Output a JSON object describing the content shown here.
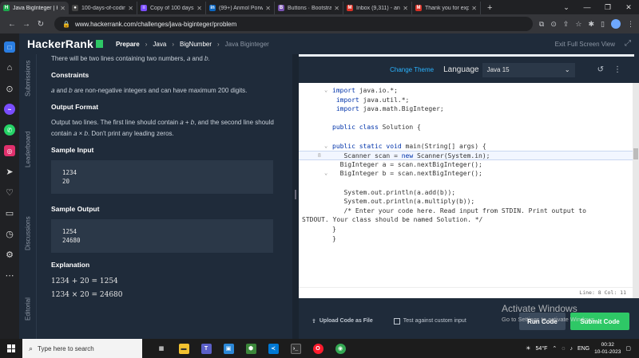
{
  "browser": {
    "tabs": [
      {
        "label": "Java BigInteger | Ha",
        "favicon": "HR",
        "color": "#1ba94c",
        "active": true
      },
      {
        "label": "100-days-of-coding",
        "favicon": "⬤",
        "color": "#444444",
        "active": false
      },
      {
        "label": "Copy of 100 days o",
        "favicon": "▤",
        "color": "#7b4dff",
        "active": false
      },
      {
        "label": "(99+) Anmol Porwa",
        "favicon": "in",
        "color": "#0a66c2",
        "active": false
      },
      {
        "label": "Buttons · Bootstrap",
        "favicon": "B",
        "color": "#7952b3",
        "active": false
      },
      {
        "label": "Inbox (9,311) - anm",
        "favicon": "M",
        "color": "#d93025",
        "active": false
      },
      {
        "label": "Thank you for expo",
        "favicon": "M",
        "color": "#d93025",
        "active": false
      }
    ],
    "new_tab": "+",
    "url": "www.hackerrank.com/challenges/java-biginteger/problem",
    "window_controls": [
      "—",
      "❐",
      "✕"
    ]
  },
  "header": {
    "logo": "HackerRank",
    "breadcrumbs": [
      "Prepare",
      "Java",
      "BigNumber",
      "Java Biginteger"
    ],
    "exit_fullscreen": "Exit Full Screen View"
  },
  "sidetabs": [
    "Submissions",
    "Leaderboard",
    "Discussions",
    "Editorial"
  ],
  "problem": {
    "intro": "There will be two lines containing two numbers, 𝑎 and 𝑏.",
    "constraints_heading": "Constraints",
    "constraints_text": "𝑎 and 𝑏 are non-negative integers and can have maximum 200 digits.",
    "output_heading": "Output Format",
    "output_text": "Output two lines. The first line should contain 𝑎 + 𝑏, and the second line should contain 𝑎 × 𝑏. Don't print any leading zeros.",
    "sample_input_heading": "Sample Input",
    "sample_input": [
      "1234",
      "20"
    ],
    "sample_output_heading": "Sample Output",
    "sample_output": [
      "1254",
      "24680"
    ],
    "explanation_heading": "Explanation",
    "explanation": [
      "1234 + 20 = 1254",
      "1234 × 20 = 24680"
    ]
  },
  "editor": {
    "change_theme": "Change Theme",
    "language_label": "Language",
    "language": "Java 15",
    "status": "Line: 8 Col: 11",
    "upload": "Upload Code as File",
    "custom_input": "Test against custom input",
    "run": "Run Code",
    "submit": "Submit Code"
  },
  "watermark": {
    "title": "Activate Windows",
    "subtitle": "Go to Settings to activate Windows."
  },
  "taskbar": {
    "search_placeholder": "Type here to search",
    "weather": "54°F",
    "lang": "ENG",
    "time": "00:32",
    "date": "10-01-2023"
  }
}
